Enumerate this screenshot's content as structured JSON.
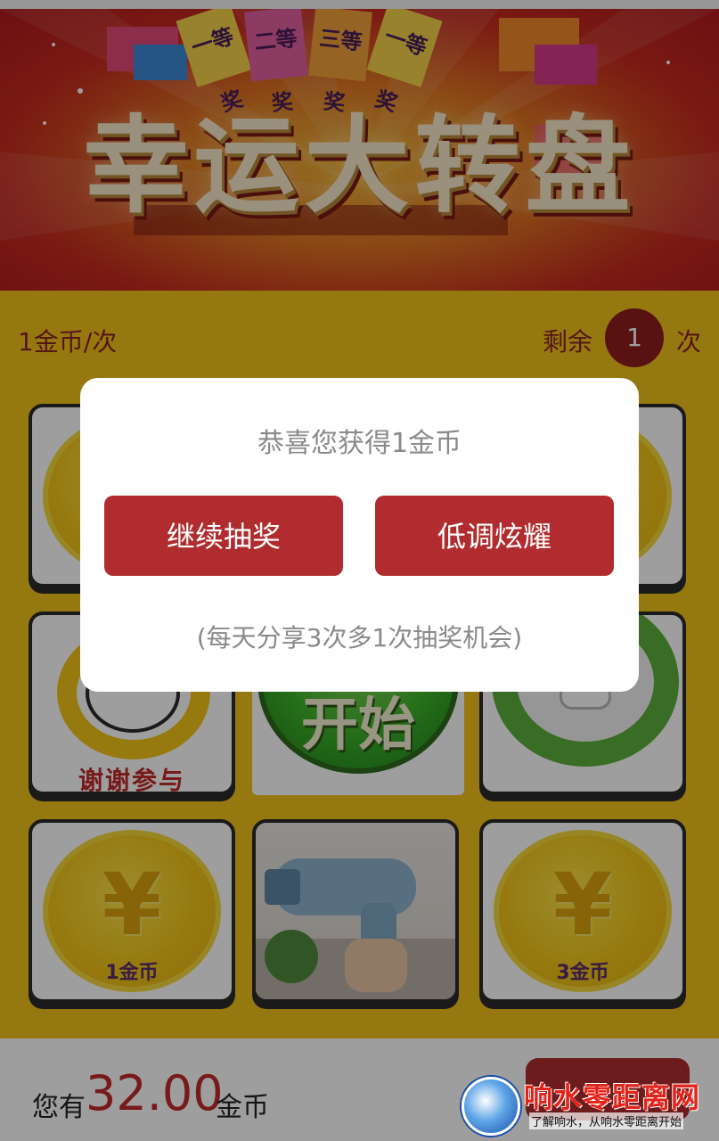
{
  "banner": {
    "title": "幸运大转盘",
    "ribbons": [
      "一等奖",
      "二等奖",
      "三等奖",
      "一等奖"
    ]
  },
  "info": {
    "cost": "1金币/次",
    "remaining_label": "剩余",
    "remaining_count": "1",
    "remaining_unit": "次"
  },
  "grid": {
    "thanks_label": "谢谢参与",
    "start_label": "开始",
    "coin_1_label": "1金币",
    "coin_3_label": "3金币",
    "yen_symbol": "¥"
  },
  "bottom": {
    "prefix": "您有",
    "amount": "32.00",
    "unit": "金币"
  },
  "dialog": {
    "message": "恭喜您获得1金币",
    "continue_label": "继续抽奖",
    "share_label": "低调炫耀",
    "note": "(每天分享3次多1次抽奖机会)"
  },
  "watermark": {
    "title": "响水零距离网",
    "subtitle": "了解响水，从响水零距离开始"
  },
  "colors": {
    "accent": "#b02c2e",
    "background": "#f2c21c",
    "banner": "#c62a1f"
  }
}
